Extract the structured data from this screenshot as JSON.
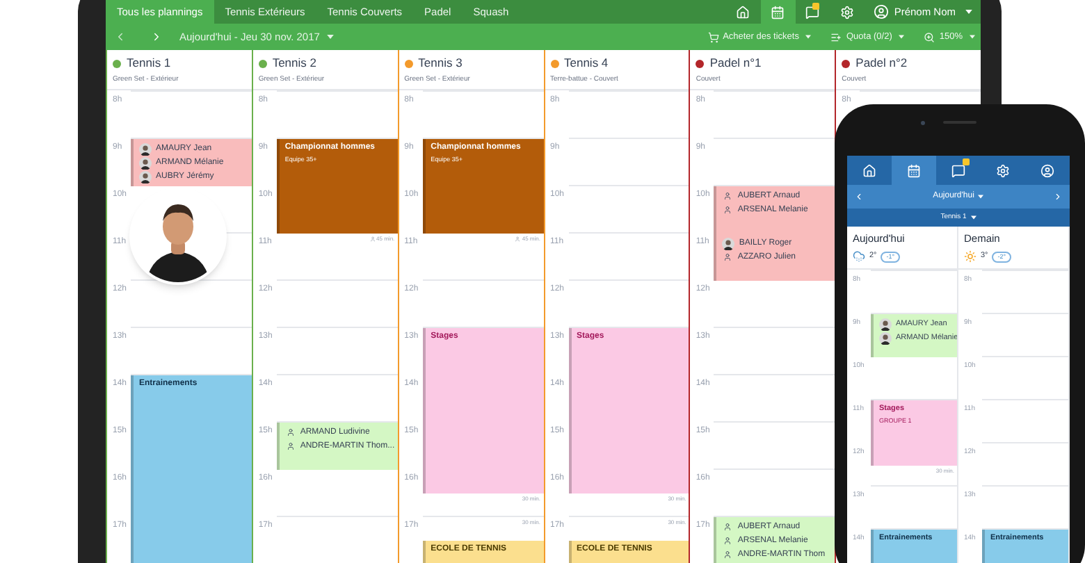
{
  "tablet": {
    "tabs": [
      {
        "label": "Tous les plannings",
        "selected": true
      },
      {
        "label": "Tennis Extérieurs",
        "selected": false
      },
      {
        "label": "Tennis Couverts",
        "selected": false
      },
      {
        "label": "Padel",
        "selected": false
      },
      {
        "label": "Squash",
        "selected": false
      }
    ],
    "nav": [
      {
        "kind": "home",
        "selected": false,
        "alert": false
      },
      {
        "kind": "calendar",
        "selected": true,
        "alert": false
      },
      {
        "kind": "messages",
        "selected": false,
        "alert": true
      },
      {
        "kind": "settings",
        "selected": false,
        "alert": false
      }
    ],
    "user": {
      "name": "Prénom Nom"
    },
    "date": "Aujourd'hui - Jeu 30 nov. 2017",
    "actions": [
      {
        "kind": "cart",
        "label": "Acheter des tickets"
      },
      {
        "kind": "quota",
        "label": "Quota (0/2)"
      },
      {
        "kind": "zoom",
        "label": "150%"
      }
    ],
    "columns": [
      {
        "name": "Tennis 1",
        "color": "#6ab04c",
        "subtitle": "Green Set - Extérieur",
        "hours": [
          {
            "label": "8h",
            "continued": false
          },
          {
            "label": "9h",
            "events": [
              {
                "kind": "booking",
                "color": "#f9bcbc",
                "people": [
                  {
                    "name": "AMAURY Jean",
                    "avatar": true
                  },
                  {
                    "name": "ARMAND Mélanie",
                    "avatar": true
                  },
                  {
                    "name": "AUBRY Jérémy",
                    "avatar": true
                  }
                ]
              }
            ]
          },
          {
            "label": "10h",
            "continued": false
          },
          {
            "label": "11h",
            "continued": false
          },
          {
            "label": "12h",
            "continued": false
          },
          {
            "label": "13h",
            "continued": false
          },
          {
            "label": "14h",
            "events": [
              {
                "kind": "training",
                "color": "#87cbea",
                "title": "Entrainements"
              }
            ]
          },
          {
            "label": "15h",
            "continued": true,
            "half": false
          },
          {
            "label": "16h",
            "continued": true,
            "half": false
          },
          {
            "label": "17h",
            "continued": true,
            "half": false
          }
        ]
      },
      {
        "name": "Tennis 2",
        "color": "#6ab04c",
        "subtitle": "Green Set - Extérieur",
        "hours": [
          {
            "label": "8h",
            "continued": false
          },
          {
            "label": "9h",
            "events": [
              {
                "kind": "championship",
                "color": "#b35c0a",
                "title": "Championnat hommes",
                "subtitle": "Equipe 35+",
                "note": "45 min."
              }
            ]
          },
          {
            "label": "10h",
            "continued": true,
            "half": false
          },
          {
            "label": "11h",
            "continued": false
          },
          {
            "label": "12h",
            "continued": false
          },
          {
            "label": "13h",
            "continued": false
          },
          {
            "label": "14h",
            "continued": false
          },
          {
            "label": "15h",
            "events": [
              {
                "kind": "booking",
                "color": "#d4f7c4",
                "people": [
                  {
                    "name": "ARMAND Ludivine",
                    "avatar": false
                  },
                  {
                    "name": "ANDRE-MARTIN Thom...",
                    "avatar": false
                  }
                ]
              }
            ]
          },
          {
            "label": "16h",
            "continued": false
          },
          {
            "label": "17h",
            "continued": false
          }
        ]
      },
      {
        "name": "Tennis 3",
        "color": "#f39a2b",
        "subtitle": "Green Set - Extérieur",
        "hours": [
          {
            "label": "8h",
            "continued": false
          },
          {
            "label": "9h",
            "events": [
              {
                "kind": "championship",
                "color": "#b35c0a",
                "title": "Championnat hommes",
                "subtitle": "Equipe 35+",
                "note": "45 min."
              }
            ]
          },
          {
            "label": "10h",
            "continued": true,
            "half": false
          },
          {
            "label": "11h",
            "continued": false
          },
          {
            "label": "12h",
            "continued": false
          },
          {
            "label": "13h",
            "events": [
              {
                "kind": "stages",
                "color": "#fbc9e4",
                "title": "Stages",
                "note": "30 min."
              }
            ]
          },
          {
            "label": "14h",
            "continued": true,
            "half": false
          },
          {
            "label": "15h",
            "continued": true,
            "half": false
          },
          {
            "label": "16h",
            "continued": true,
            "half": true
          },
          {
            "label": "17h",
            "note": "30 min.",
            "events": [
              {
                "kind": "school",
                "color": "#fbdf8e",
                "half_past": true,
                "title": "ECOLE DE TENNIS"
              }
            ]
          }
        ]
      },
      {
        "name": "Tennis 4",
        "color": "#f39a2b",
        "subtitle": "Terre-battue - Couvert",
        "hours": [
          {
            "label": "8h",
            "continued": false
          },
          {
            "label": "9h",
            "continued": false
          },
          {
            "label": "10h",
            "continued": false
          },
          {
            "label": "11h",
            "continued": false
          },
          {
            "label": "12h",
            "continued": false
          },
          {
            "label": "13h",
            "events": [
              {
                "kind": "stages",
                "color": "#fbc9e4",
                "title": "Stages",
                "note": "30 min."
              }
            ]
          },
          {
            "label": "14h",
            "continued": true,
            "half": false
          },
          {
            "label": "15h",
            "continued": true,
            "half": false
          },
          {
            "label": "16h",
            "continued": true,
            "half": true
          },
          {
            "label": "17h",
            "note": "30 min.",
            "events": [
              {
                "kind": "school",
                "color": "#fbdf8e",
                "half_past": true,
                "title": "ECOLE DE TENNIS"
              }
            ]
          }
        ]
      },
      {
        "name": "Padel n°1",
        "color": "#b3262a",
        "subtitle": "Couvert",
        "hours": [
          {
            "label": "8h",
            "continued": false
          },
          {
            "label": "9h",
            "continued": false
          },
          {
            "label": "10h",
            "events": [
              {
                "kind": "booking",
                "color": "#f9bcbc",
                "people": [
                  {
                    "name": "AUBERT Arnaud",
                    "avatar": false
                  },
                  {
                    "name": "ARSENAL Melanie",
                    "avatar": false
                  }
                ]
              }
            ]
          },
          {
            "label": "11h",
            "events": [
              {
                "kind": "booking",
                "color": "#f9bcbc",
                "people": [
                  {
                    "name": "BAILLY Roger",
                    "avatar": true
                  },
                  {
                    "name": "AZZARO Julien",
                    "avatar": false
                  }
                ]
              }
            ]
          },
          {
            "label": "12h",
            "continued": false
          },
          {
            "label": "13h",
            "continued": false
          },
          {
            "label": "14h",
            "continued": false
          },
          {
            "label": "15h",
            "continued": false
          },
          {
            "label": "16h",
            "continued": false
          },
          {
            "label": "17h",
            "events": [
              {
                "kind": "booking",
                "color": "#d4f7c4",
                "people": [
                  {
                    "name": "AUBERT Arnaud",
                    "avatar": false
                  },
                  {
                    "name": "ARSENAL Melanie",
                    "avatar": false
                  },
                  {
                    "name": "ANDRE-MARTIN Thom",
                    "avatar": false
                  }
                ]
              }
            ]
          }
        ]
      },
      {
        "name": "Padel n°2",
        "color": "#b3262a",
        "subtitle": "Couvert",
        "hours": [
          {
            "label": "8h",
            "continued": false
          }
        ]
      }
    ]
  },
  "phone": {
    "nav": [
      {
        "kind": "home",
        "selected": false,
        "alert": false
      },
      {
        "kind": "calendar",
        "selected": true,
        "alert": false
      },
      {
        "kind": "messages",
        "selected": false,
        "alert": true
      },
      {
        "kind": "settings",
        "selected": false,
        "alert": false
      },
      {
        "kind": "profile",
        "selected": false,
        "alert": false
      }
    ],
    "date": "Aujourd'hui",
    "court": "Tennis 1",
    "days": [
      {
        "title": "Aujourd'hui",
        "kind": "snow",
        "temp": "2°",
        "low": "-1°",
        "hours": [
          {
            "label": "8h",
            "continued": false
          },
          {
            "label": "9h",
            "events": [
              {
                "kind": "booking",
                "color": "#d4f7c4",
                "people": [
                  {
                    "name": "AMAURY Jean",
                    "avatar": true
                  },
                  {
                    "name": "ARMAND Mélanie",
                    "avatar": true
                  }
                ]
              }
            ]
          },
          {
            "label": "10h",
            "continued": false
          },
          {
            "label": "11h",
            "events": [
              {
                "kind": "stages",
                "color": "#fbc9e4",
                "title": "Stages",
                "subtitle": "GROUPE 1",
                "note": "30 min."
              }
            ]
          },
          {
            "label": "12h",
            "continued": true,
            "half": true
          },
          {
            "label": "13h",
            "continued": false
          },
          {
            "label": "14h",
            "events": [
              {
                "kind": "training",
                "color": "#87cbea",
                "title": "Entrainements"
              }
            ]
          }
        ]
      },
      {
        "title": "Demain",
        "kind": "sun",
        "temp": "3°",
        "low": "-2°",
        "hours": [
          {
            "label": "8h",
            "continued": false
          },
          {
            "label": "9h",
            "continued": false
          },
          {
            "label": "10h",
            "continued": false
          },
          {
            "label": "11h",
            "continued": false
          },
          {
            "label": "12h",
            "continued": false
          },
          {
            "label": "13h",
            "continued": false
          },
          {
            "label": "14h",
            "events": [
              {
                "kind": "training",
                "color": "#87cbea",
                "title": "Entrainements"
              }
            ]
          }
        ]
      }
    ]
  }
}
